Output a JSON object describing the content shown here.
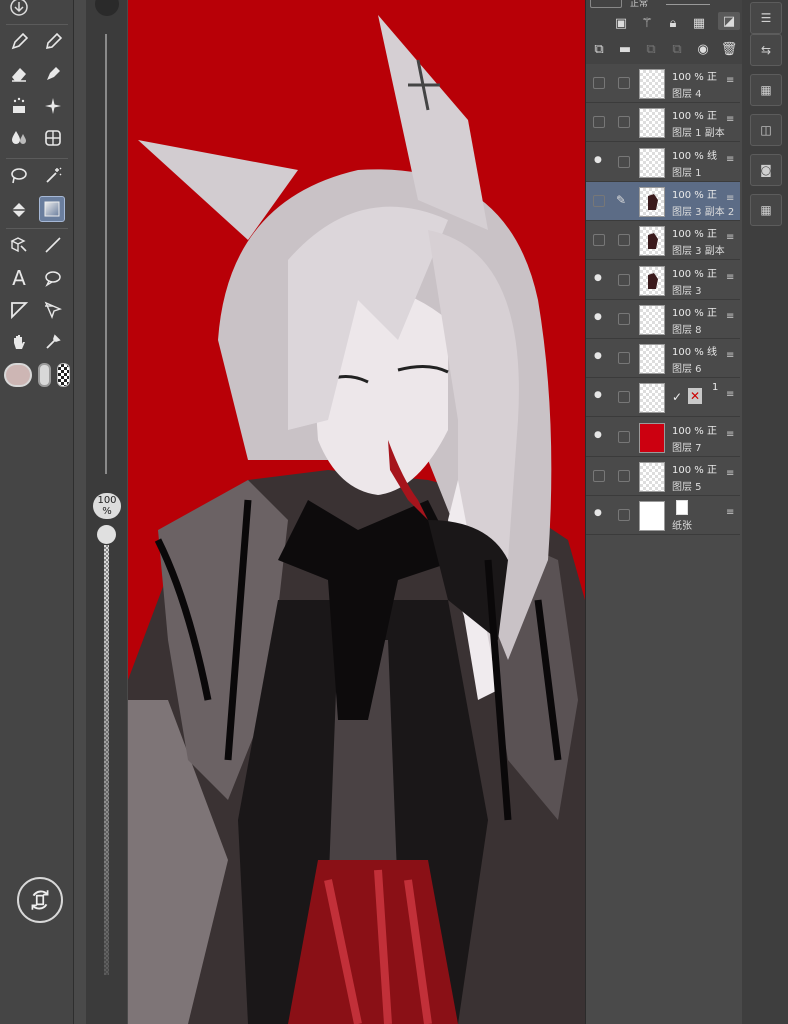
{
  "brush_size_label": "100\n%",
  "blend_mode_label": "正常",
  "layers": [
    {
      "opacity": "100 % 正",
      "name": "图层 4",
      "visible": false,
      "thumb": "empty"
    },
    {
      "opacity": "100 % 正",
      "name": "图层 1 副本",
      "visible": false,
      "thumb": "empty"
    },
    {
      "opacity": "100 % 线",
      "name": "图层 1",
      "visible": true,
      "thumb": "empty"
    },
    {
      "opacity": "100 % 正",
      "name": "图层 3 副本 2",
      "visible": false,
      "thumb": "figure",
      "selected": true
    },
    {
      "opacity": "100 % 正",
      "name": "图层 3 副本",
      "visible": false,
      "thumb": "figure"
    },
    {
      "opacity": "100 % 正",
      "name": "图层 3",
      "visible": true,
      "thumb": "figure"
    },
    {
      "opacity": "100 % 正",
      "name": "图层 8",
      "visible": true,
      "thumb": "empty"
    },
    {
      "opacity": "100 % 线",
      "name": "图层 6",
      "visible": true,
      "thumb": "empty"
    },
    {
      "opacity": "1",
      "name": "",
      "visible": true,
      "thumb": "empty",
      "folder": true
    },
    {
      "opacity": "100 % 正",
      "name": "图层 7",
      "visible": true,
      "thumb": "red"
    },
    {
      "opacity": "100 % 正",
      "name": "图层 5",
      "visible": false,
      "thumb": "empty"
    },
    {
      "opacity": "",
      "name": "纸张",
      "visible": true,
      "thumb": "white"
    }
  ],
  "colors": {
    "canvas_bg": "#b80007",
    "selected_layer": "#5c6c86",
    "main_color": "#cdb6b4"
  }
}
